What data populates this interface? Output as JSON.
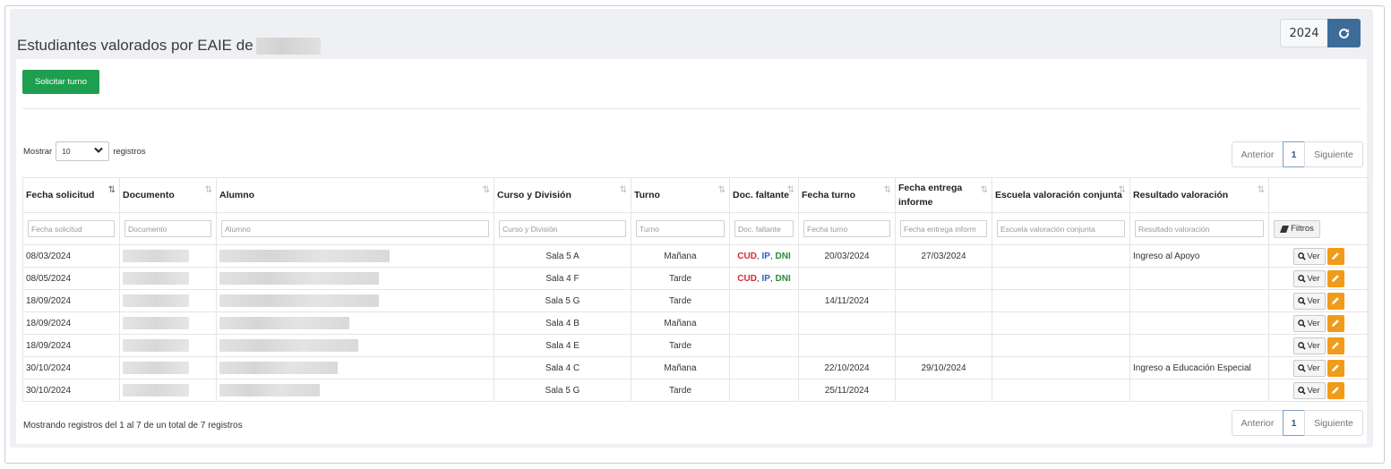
{
  "header": {
    "title": "Estudiantes valorados por EAIE de",
    "year": "2024",
    "refresh_icon": "refresh-icon"
  },
  "toolbar": {
    "solicitar_label": "Solicitar turno"
  },
  "length": {
    "prefix": "Mostrar",
    "value": "10",
    "suffix": "registros"
  },
  "pagination": {
    "prev": "Anterior",
    "page": "1",
    "next": "Siguiente"
  },
  "columns": [
    "Fecha solicitud",
    "Documento",
    "Alumno",
    "Curso y División",
    "Turno",
    "Doc. faltante",
    "Fecha turno",
    "Fecha entrega informe",
    "Escuela valoración conjunta",
    "Resultado valoración",
    ""
  ],
  "filters": {
    "fecha_solicitud": "Fecha solicitud",
    "documento": "Documento",
    "alumno": "Alumno",
    "curso": "Curso y División",
    "turno": "Turno",
    "doc_faltante": "Doc. faltante",
    "fecha_turno": "Fecha turno",
    "fecha_entrega": "Fecha entrega inform",
    "escuela": "Escuela valoración conjunta",
    "resultado": "Resultado valoración",
    "filtros_label": "Filtros"
  },
  "doc_labels": {
    "cud": "CUD",
    "ip": "IP",
    "dni": "DNI"
  },
  "rows": [
    {
      "fecha_solicitud": "08/03/2024",
      "curso": "Sala 5 A",
      "turno": "Mañana",
      "doc_faltante": true,
      "fecha_turno": "20/03/2024",
      "fecha_entrega": "27/03/2024",
      "escuela": "",
      "resultado": "Ingreso al Apoyo"
    },
    {
      "fecha_solicitud": "08/05/2024",
      "curso": "Sala 4 F",
      "turno": "Tarde",
      "doc_faltante": true,
      "fecha_turno": "",
      "fecha_entrega": "",
      "escuela": "",
      "resultado": ""
    },
    {
      "fecha_solicitud": "18/09/2024",
      "curso": "Sala 5 G",
      "turno": "Tarde",
      "doc_faltante": false,
      "fecha_turno": "14/11/2024",
      "fecha_entrega": "",
      "escuela": "",
      "resultado": ""
    },
    {
      "fecha_solicitud": "18/09/2024",
      "curso": "Sala 4 B",
      "turno": "Mañana",
      "doc_faltante": false,
      "fecha_turno": "",
      "fecha_entrega": "",
      "escuela": "",
      "resultado": ""
    },
    {
      "fecha_solicitud": "18/09/2024",
      "curso": "Sala 4 E",
      "turno": "Tarde",
      "doc_faltante": false,
      "fecha_turno": "",
      "fecha_entrega": "",
      "escuela": "",
      "resultado": ""
    },
    {
      "fecha_solicitud": "30/10/2024",
      "curso": "Sala 4 C",
      "turno": "Mañana",
      "doc_faltante": false,
      "fecha_turno": "22/10/2024",
      "fecha_entrega": "29/10/2024",
      "escuela": "",
      "resultado": "Ingreso a Educación Especial"
    },
    {
      "fecha_solicitud": "30/10/2024",
      "curso": "Sala 5 G",
      "turno": "Tarde",
      "doc_faltante": false,
      "fecha_turno": "25/11/2024",
      "fecha_entrega": "",
      "escuela": "",
      "resultado": ""
    }
  ],
  "row_actions": {
    "ver_label": "Ver"
  },
  "footer": {
    "info": "Mostrando registros del 1 al 7 de un total de 7 registros"
  },
  "colors": {
    "primary": "#3d6c99",
    "success": "#1e9e4f",
    "warning": "#f19b1a",
    "cud": "#d6282f",
    "ip": "#2b61c6",
    "dni": "#2a8a3d"
  }
}
